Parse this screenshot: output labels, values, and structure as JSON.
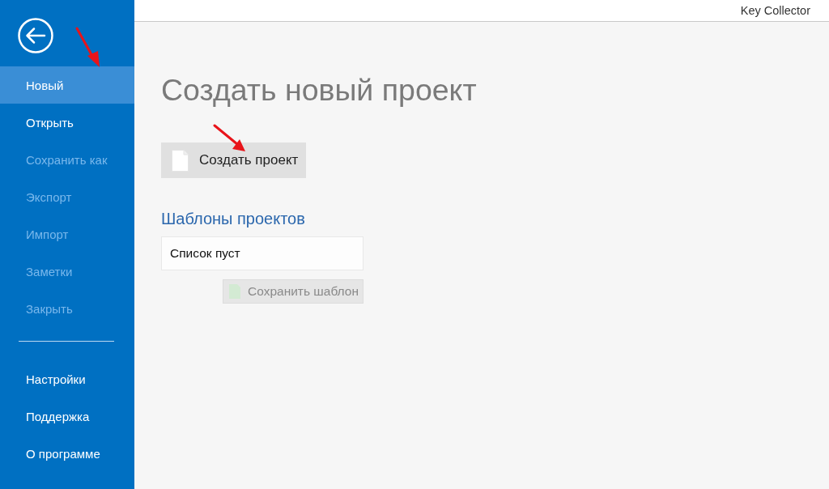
{
  "window": {
    "title": "Key Collector"
  },
  "sidebar": {
    "items": [
      {
        "label": "Новый",
        "selected": true,
        "disabled": false
      },
      {
        "label": "Открыть",
        "selected": false,
        "disabled": false
      },
      {
        "label": "Сохранить как",
        "selected": false,
        "disabled": true
      },
      {
        "label": "Экспорт",
        "selected": false,
        "disabled": true
      },
      {
        "label": "Импорт",
        "selected": false,
        "disabled": true
      },
      {
        "label": "Заметки",
        "selected": false,
        "disabled": true
      },
      {
        "label": "Закрыть",
        "selected": false,
        "disabled": true
      }
    ],
    "footer_items": [
      {
        "label": "Настройки",
        "selected": false,
        "disabled": false
      },
      {
        "label": "Поддержка",
        "selected": false,
        "disabled": false
      },
      {
        "label": "О программе",
        "selected": false,
        "disabled": false
      }
    ]
  },
  "main": {
    "heading": "Создать новый проект",
    "create_button": {
      "label": "Создать проект"
    },
    "templates": {
      "title": "Шаблоны проектов",
      "empty_text": "Список пуст",
      "save_button": {
        "label": "Сохранить шаблон",
        "disabled": true
      }
    }
  }
}
